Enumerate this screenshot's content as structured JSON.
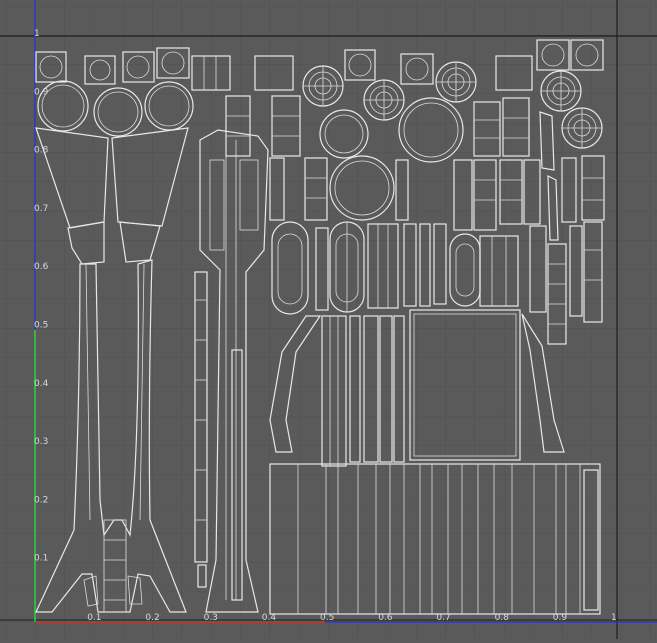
{
  "viewport": {
    "background": "#5a5a5a",
    "grid_color": "#505050",
    "frame_color": "#1e1e1e",
    "uv_line_color": "#e8e8e8",
    "axis_u_color": "#c0392b",
    "axis_v_color": "#2ecc40",
    "axis_blue_color": "#2b36c8"
  },
  "axes": {
    "v_ticks": [
      "1",
      "0.9",
      "0.8",
      "0.7",
      "0.6",
      "0.5",
      "0.4",
      "0.3",
      "0.2",
      "0.1"
    ],
    "u_ticks": [
      "0.1",
      "0.2",
      "0.3",
      "0.4",
      "0.5",
      "0.6",
      "0.7",
      "0.8",
      "0.9",
      "1"
    ]
  }
}
